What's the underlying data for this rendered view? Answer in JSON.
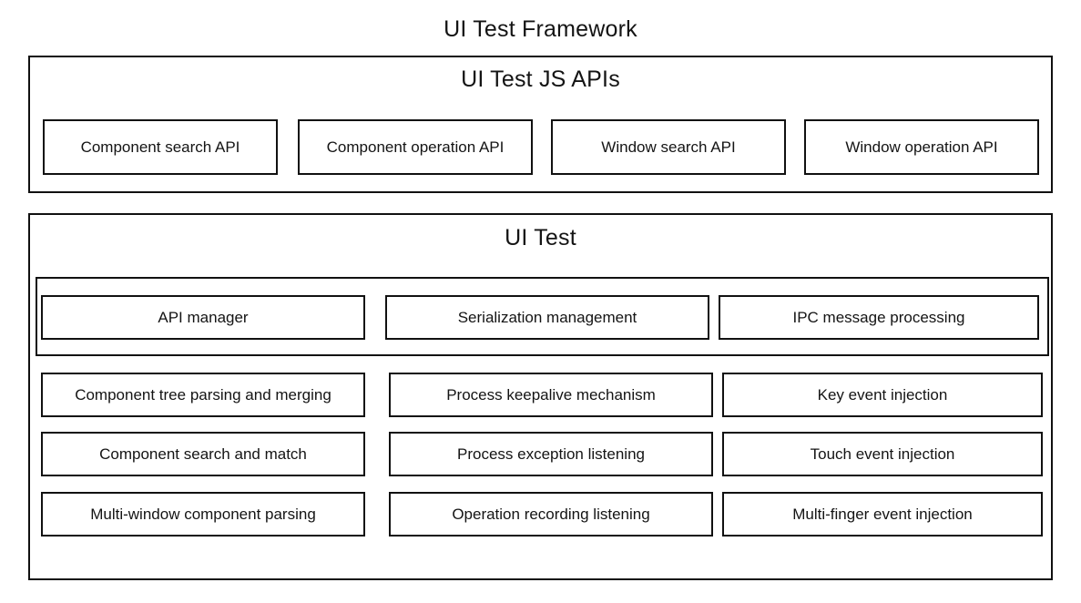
{
  "diagram": {
    "title": "UI Test Framework",
    "type": "layered-architecture-block-diagram"
  },
  "sections": [
    {
      "id": "ui-test-js-apis",
      "title": "UI Test JS APIs",
      "items": [
        "Component search API",
        "Component operation  API",
        "Window search API",
        "Window operation  API"
      ]
    },
    {
      "id": "ui-test",
      "title": "UI Test",
      "group": {
        "id": "ui-test-core-group",
        "items": [
          "API manager",
          "Serialization management",
          "IPC message processing"
        ]
      },
      "rows": [
        [
          "Component tree parsing and merging",
          "Process keepalive mechanism",
          "Key event injection"
        ],
        [
          "Component search and match",
          "Process exception listening",
          "Touch event injection"
        ],
        [
          "Multi-window component parsing",
          "Operation recording listening",
          "Multi-finger event injection"
        ]
      ]
    }
  ],
  "colors": {
    "background": "#ffffff",
    "stroke": "#111111",
    "text": "#141414"
  }
}
